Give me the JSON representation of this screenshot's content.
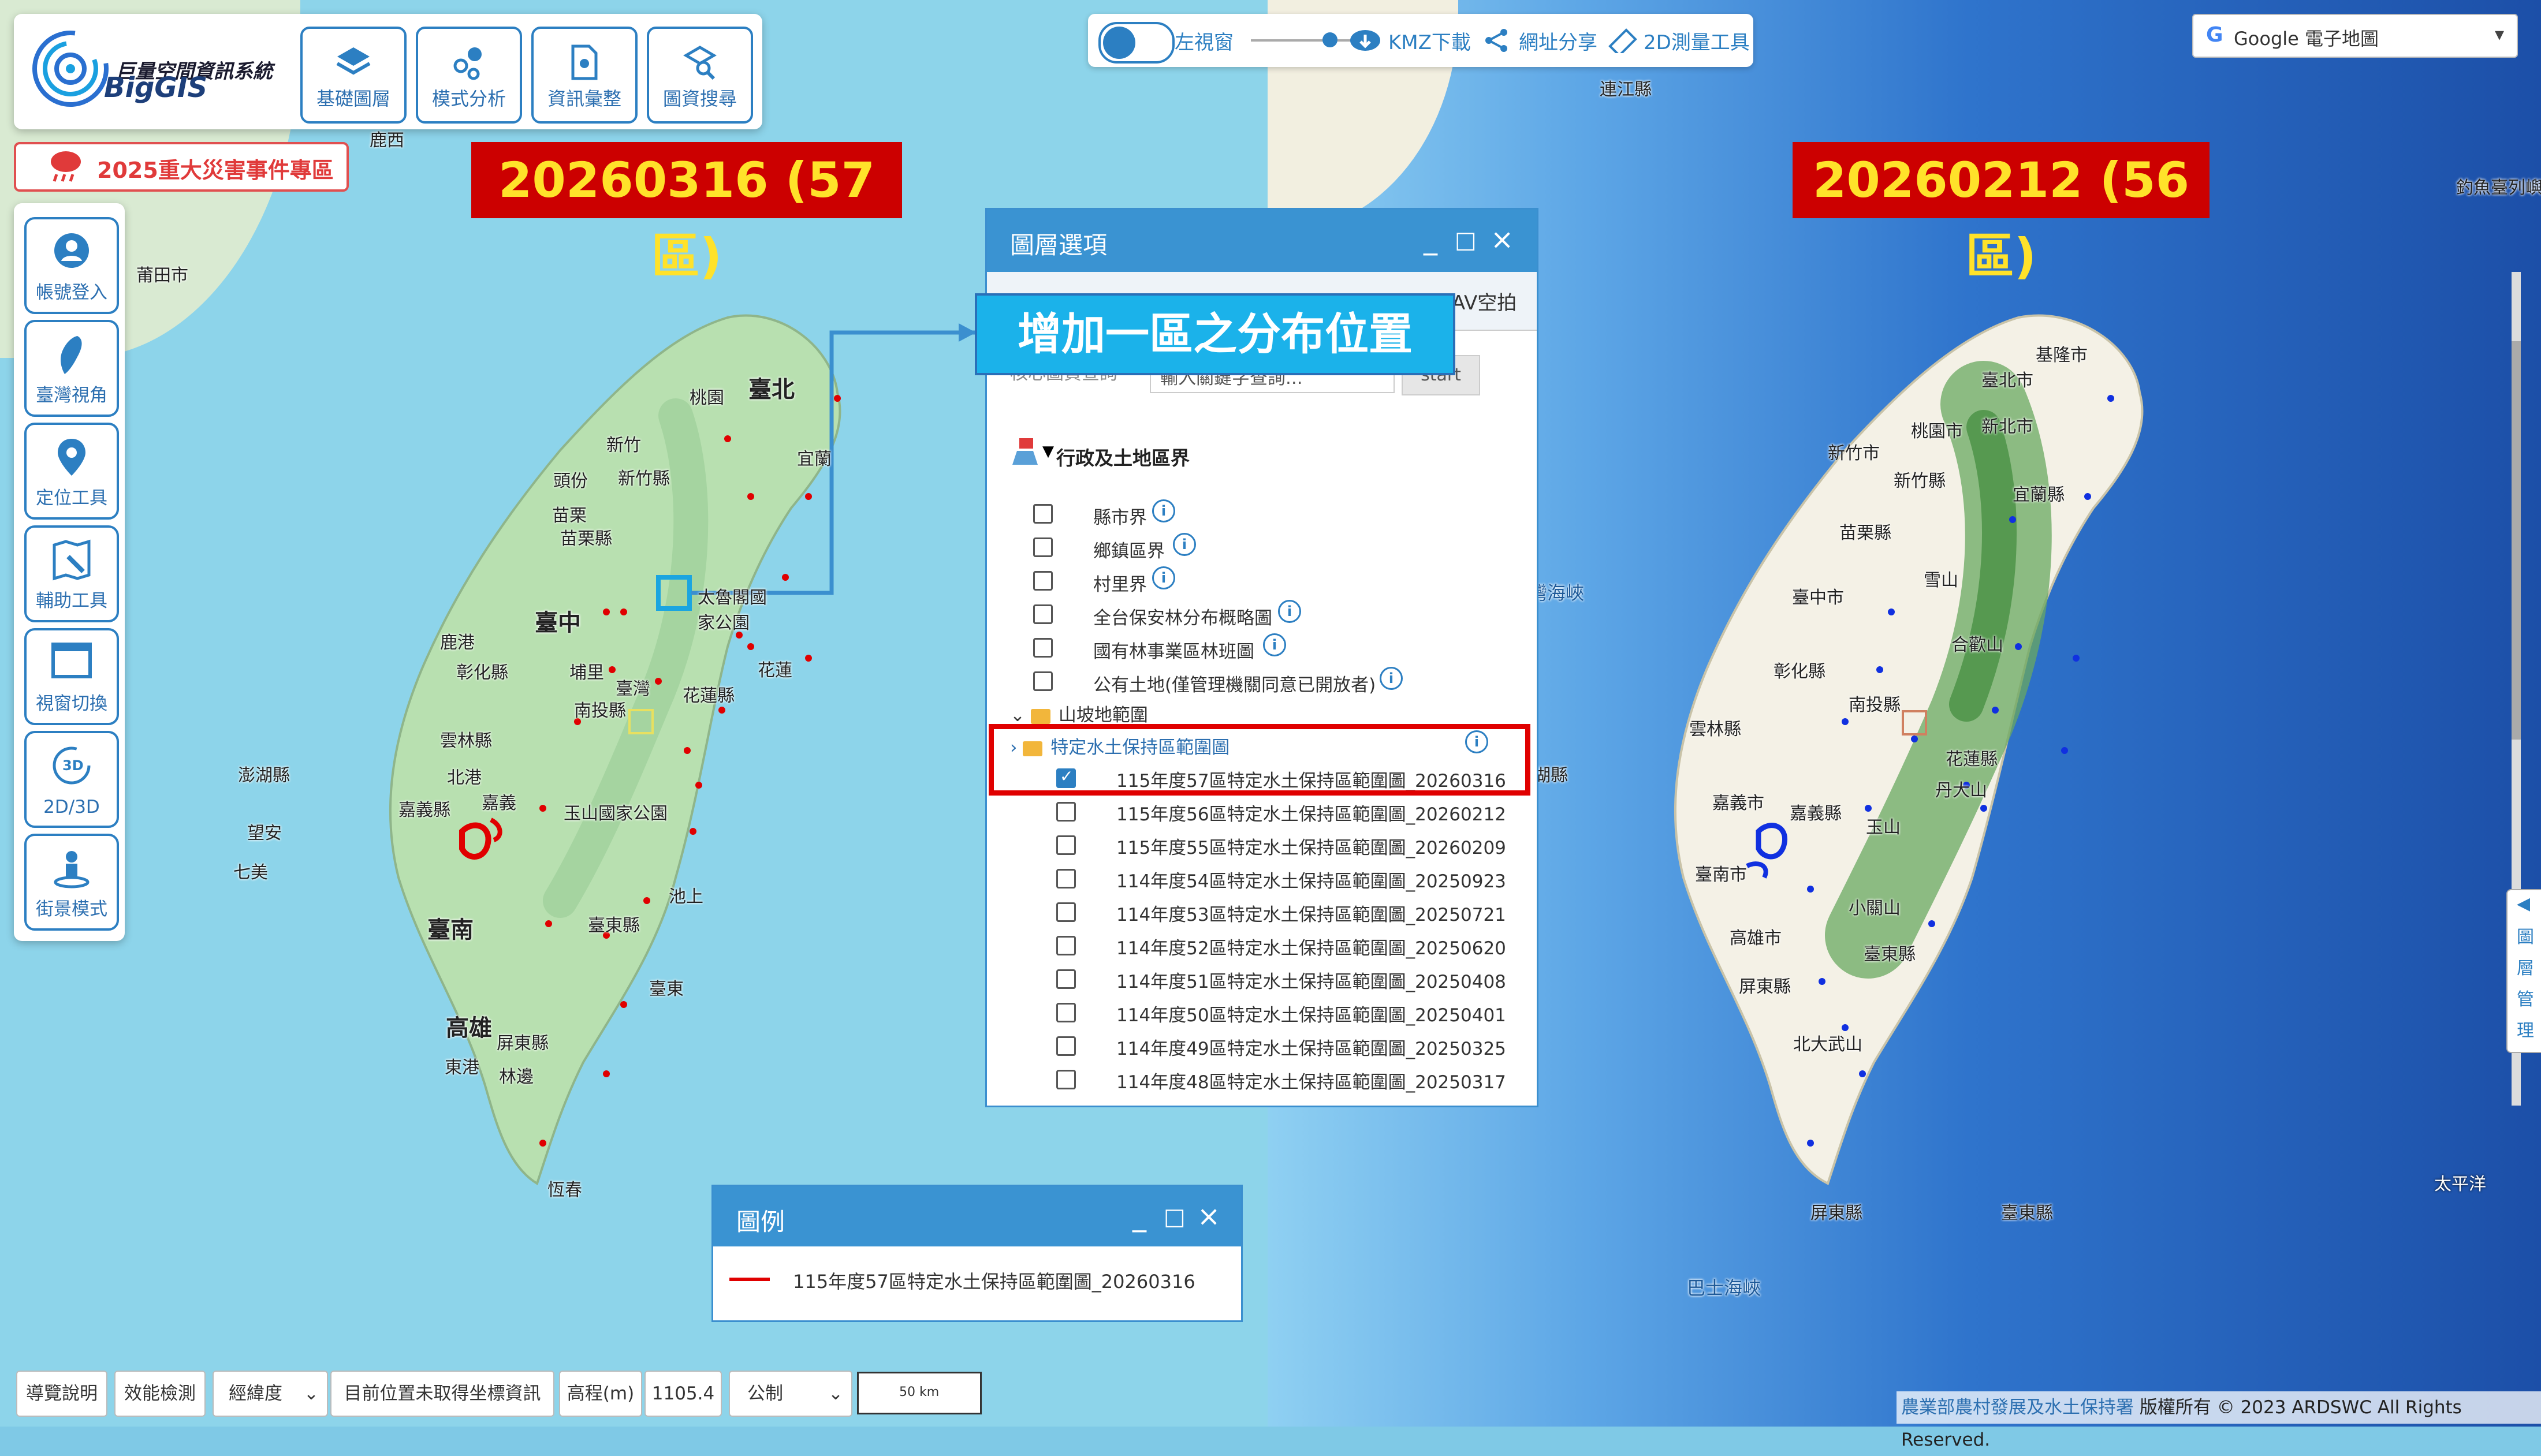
{
  "app": {
    "logo_title": "巨量空間資訊系統",
    "logo_sub": "BigGIS",
    "top_buttons": [
      {
        "label": "基礎圖層",
        "icon": "layers-icon"
      },
      {
        "label": "模式分析",
        "icon": "analysis-icon"
      },
      {
        "label": "資訊彙整",
        "icon": "document-pin-icon"
      },
      {
        "label": "圖資搜尋",
        "icon": "search-doc-icon"
      }
    ],
    "event_button": "2025重大災害事件專區",
    "side_buttons": [
      {
        "label": "帳號登入",
        "icon": "user-icon"
      },
      {
        "label": "臺灣視角",
        "icon": "taiwan-icon"
      },
      {
        "label": "定位工具",
        "icon": "location-pin-icon"
      },
      {
        "label": "輔助工具",
        "icon": "tools-icon"
      },
      {
        "label": "視窗切換",
        "icon": "window-icon"
      },
      {
        "label": "2D/3D",
        "icon": "3d-icon",
        "sub": "3D"
      },
      {
        "label": "街景模式",
        "icon": "street-view-icon"
      }
    ]
  },
  "titles": {
    "left": "20260316 (57區)",
    "right": "20260212 (56區)"
  },
  "toolbar": {
    "left_window": "左視窗",
    "kmz": "KMZ下載",
    "share": "網址分享",
    "measure": "2D測量工具"
  },
  "basemap_select": {
    "value": "Google 電子地圖",
    "g": "G"
  },
  "layer_panel": {
    "title": "圖層選項",
    "tab_uav": "UAV空拍",
    "core_label": "核心圖資查詢",
    "search_placeholder": "輸入關鍵字查詢...",
    "start": "start",
    "section_title": "行政及土地區界",
    "rows": [
      "縣市界",
      "鄉鎮區界",
      "村里界",
      "全台保安林分布概略圖",
      "國有林事業區林班圖",
      "公有土地(僅管理機關同意已開放者)"
    ],
    "slope_folder": "山坡地範圍",
    "sub_folder": "特定水土保持區範圍圖",
    "layers": [
      {
        "label": "115年度57區特定水土保持區範圍圖_20260316",
        "checked": true
      },
      {
        "label": "115年度56區特定水土保持區範圍圖_20260212",
        "checked": false
      },
      {
        "label": "115年度55區特定水土保持區範圍圖_20260209",
        "checked": false
      },
      {
        "label": "114年度54區特定水土保持區範圍圖_20250923",
        "checked": false
      },
      {
        "label": "114年度53區特定水土保持區範圍圖_20250721",
        "checked": false
      },
      {
        "label": "114年度52區特定水土保持區範圍圖_20250620",
        "checked": false
      },
      {
        "label": "114年度51區特定水土保持區範圍圖_20250408",
        "checked": false
      },
      {
        "label": "114年度50區特定水土保持區範圍圖_20250401",
        "checked": false
      },
      {
        "label": "114年度49區特定水土保持區範圍圖_20250325",
        "checked": false
      },
      {
        "label": "114年度48區特定水土保持區範圍圖_20250317",
        "checked": false
      }
    ]
  },
  "callout": "增加一區之分布位置",
  "legend": {
    "title": "圖例",
    "item": "115年度57區特定水土保持區範圍圖_20260316",
    "color": "#e00000"
  },
  "bottom_bar": {
    "guide": "導覽說明",
    "perf": "效能檢測",
    "coord_mode": "經緯度",
    "coord_status": "目前位置未取得坐標資訊",
    "elev_label": "高程(m)",
    "elev_value": "1105.4",
    "unit": "公制",
    "scale": "50 km"
  },
  "copyright": {
    "agency": "農業部農村發展及水土保持署",
    "text": "版權所有 © 2023 ARDSWC All Rights Reserved."
  },
  "right_tab": [
    "◀",
    "圖",
    "層",
    "管",
    "理"
  ],
  "places_left": [
    "莆田市",
    "臺北",
    "桃園",
    "新竹",
    "新竹縣",
    "頭份",
    "苗栗",
    "苗栗縣",
    "宜蘭",
    "太魯閣國家公園",
    "臺中",
    "鹿港",
    "彰化縣",
    "埔里",
    "臺灣",
    "南投縣",
    "花蓮縣",
    "花蓮",
    "雲林縣",
    "北港",
    "嘉義",
    "嘉義縣",
    "玉山國家公園",
    "池上",
    "臺南",
    "臺東縣",
    "臺東",
    "高雄",
    "屏東縣",
    "林邊",
    "東港",
    "恆春",
    "澎湖縣",
    "望安",
    "七美",
    "鹿西"
  ],
  "places_right": [
    "連江縣",
    "基隆市",
    "臺北市",
    "新北市",
    "桃園市",
    "新竹市",
    "新竹縣",
    "宜蘭縣",
    "苗栗縣",
    "雪山",
    "臺中市",
    "合歡山",
    "彰化縣",
    "南投縣",
    "雲林縣",
    "花蓮縣",
    "丹大山",
    "嘉義市",
    "嘉義縣",
    "玉山",
    "臺南市",
    "小關山",
    "高雄市",
    "臺東縣",
    "屏東縣",
    "北大武山",
    "屏東縣",
    "臺東縣",
    "巴士海峽",
    "太平洋",
    "釣魚臺列嶼",
    "臺灣海峽",
    "湖縣"
  ]
}
